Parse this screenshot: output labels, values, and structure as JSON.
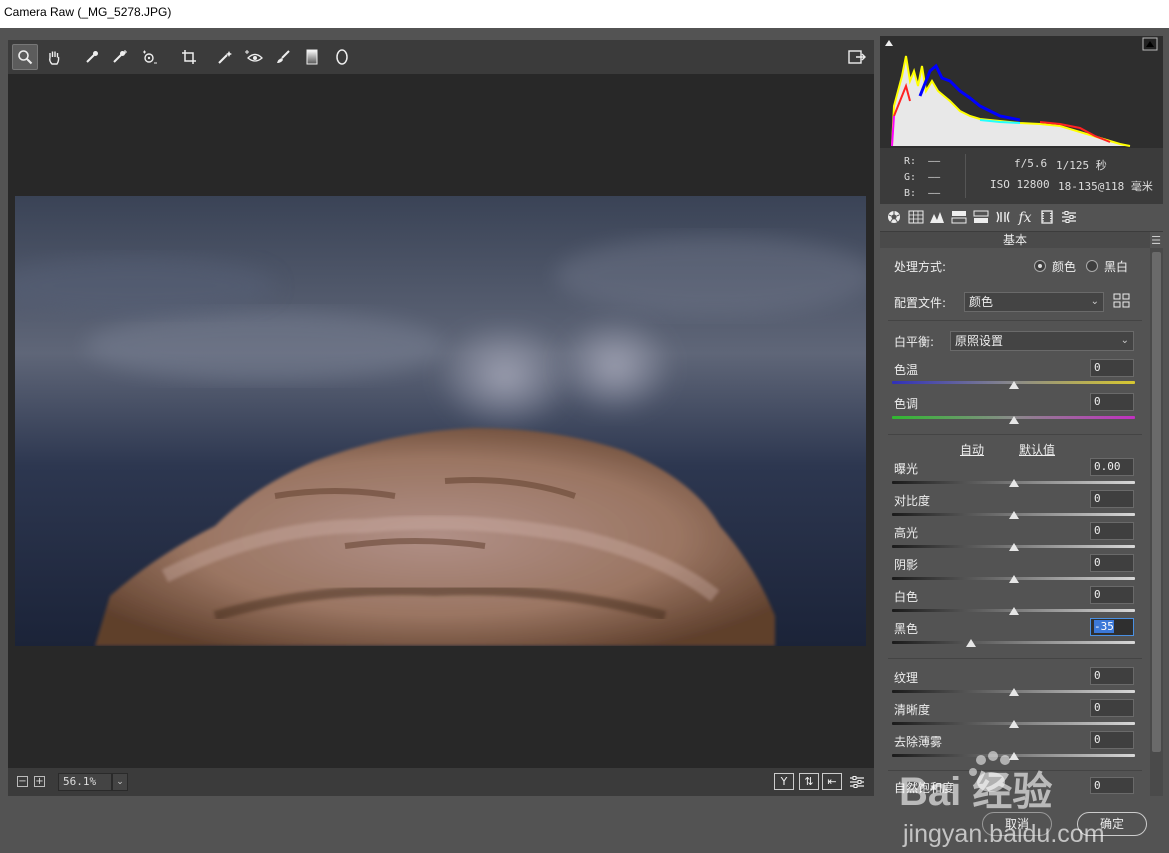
{
  "window": {
    "title": "Camera Raw (_MG_5278.JPG)"
  },
  "toolbar": {
    "tools": [
      {
        "name": "zoom-tool",
        "glyph": "🔍"
      },
      {
        "name": "hand-tool",
        "glyph": "✋"
      },
      {
        "name": "white-balance-tool",
        "glyph": "⟋"
      },
      {
        "name": "color-sampler-tool",
        "glyph": "✥"
      },
      {
        "name": "targeted-adjustment-tool",
        "glyph": "⊙"
      },
      {
        "name": "crop-tool",
        "glyph": "⌗"
      },
      {
        "name": "spot-removal-tool",
        "glyph": "⤧"
      },
      {
        "name": "red-eye-tool",
        "glyph": "👁"
      },
      {
        "name": "adjustment-brush-tool",
        "glyph": "🖌"
      },
      {
        "name": "graduated-filter-tool",
        "glyph": "▮"
      },
      {
        "name": "radial-filter-tool",
        "glyph": "◯"
      }
    ],
    "open_preferences_icon": "export-icon"
  },
  "status": {
    "zoom": "56.1%"
  },
  "info": {
    "r_label": "R:",
    "g_label": "G:",
    "b_label": "B:",
    "r_val": "——",
    "g_val": "——",
    "b_val": "——",
    "aperture": "f/5.6",
    "shutter": "1/125 秒",
    "iso": "ISO 12800",
    "lens": "18-135@118 毫米"
  },
  "panel": {
    "section_title": "基本",
    "treatment_label": "处理方式:",
    "treatment_color": "颜色",
    "treatment_bw": "黑白",
    "profile_label": "配置文件:",
    "profile_value": "颜色",
    "wb_label": "白平衡:",
    "wb_value": "原照设置",
    "auto_link": "自动",
    "default_link": "默认值",
    "sliders": {
      "temp": {
        "label": "色温",
        "value": "0",
        "level": 0.5
      },
      "tint": {
        "label": "色调",
        "value": "0",
        "level": 0.5
      },
      "exposure": {
        "label": "曝光",
        "value": "0.00",
        "level": 0.5
      },
      "contrast": {
        "label": "对比度",
        "value": "0",
        "level": 0.5
      },
      "highlights": {
        "label": "高光",
        "value": "0",
        "level": 0.5
      },
      "shadows": {
        "label": "阴影",
        "value": "0",
        "level": 0.5
      },
      "whites": {
        "label": "白色",
        "value": "0",
        "level": 0.5
      },
      "blacks": {
        "label": "黑色",
        "value": "-35",
        "level": 0.325
      },
      "texture": {
        "label": "纹理",
        "value": "0",
        "level": 0.5
      },
      "clarity": {
        "label": "清晰度",
        "value": "0",
        "level": 0.5
      },
      "dehaze": {
        "label": "去除薄雾",
        "value": "0",
        "level": 0.5
      },
      "vibrance": {
        "label": "自然饱和度",
        "value": "0",
        "level": 0.5
      }
    }
  },
  "buttons": {
    "cancel": "取消",
    "ok": "确定"
  },
  "watermark": {
    "logo_text": "Bai 经验",
    "url": "jingyan.baidu.com"
  }
}
